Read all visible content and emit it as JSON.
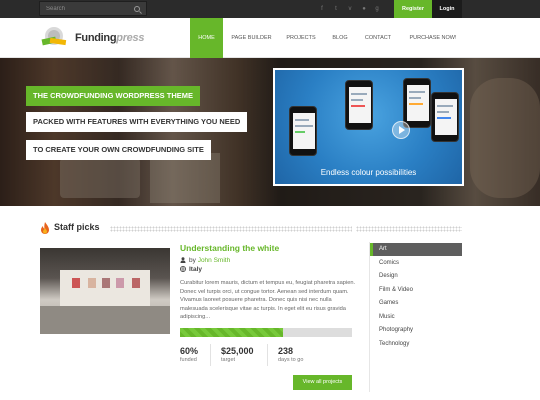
{
  "topbar": {
    "search_placeholder": "Search",
    "social_icons": [
      "facebook-icon",
      "twitter-icon",
      "vimeo-icon",
      "flickr-icon",
      "googleplus-icon",
      "rss-icon"
    ],
    "register_label": "Register",
    "login_label": "Login"
  },
  "logo": {
    "bold": "Funding",
    "light": "press"
  },
  "nav": {
    "items": [
      {
        "label": "HOME"
      },
      {
        "label": "PAGE BUILDER"
      },
      {
        "label": "PROJECTS"
      },
      {
        "label": "BLOG"
      },
      {
        "label": "CONTACT"
      },
      {
        "label": "PURCHASE NOW!"
      }
    ]
  },
  "hero": {
    "line1": "THE CROWDFUNDING WORDPRESS THEME",
    "line2": "PACKED WITH FEATURES WITH EVERYTHING YOU NEED",
    "line3": "TO CREATE YOUR OWN CROWDFUNDING SITE",
    "slide_caption": "Endless colour possibilities"
  },
  "staff": {
    "heading": "Staff picks",
    "project": {
      "title": "Understanding the white",
      "by_label": "by",
      "author": "John Smith",
      "location": "Italy",
      "description": "Curabitur lorem mauris, dictum et tempus eu, feugiat pharetra sapien. Donec vel turpis orci, ut congue tortor. Aenean sed interdum quam. Vivamus laoreet posuere pharetra. Donec quis nisi nec nulla malesuada scelerisque vitae ac turpis. In eget elit eu risus gravida adipiscing...",
      "progress_percent": 60,
      "stats": {
        "funded_value": "60%",
        "funded_label": "funded",
        "target_value": "$25,000",
        "target_label": "target",
        "days_value": "238",
        "days_label": "days to go"
      }
    },
    "view_all_label": "View all projects"
  },
  "categories": {
    "items": [
      {
        "label": "Art",
        "active": true
      },
      {
        "label": "Comics"
      },
      {
        "label": "Design"
      },
      {
        "label": "Film & Video"
      },
      {
        "label": "Games"
      },
      {
        "label": "Music"
      },
      {
        "label": "Photography"
      },
      {
        "label": "Technology"
      }
    ]
  },
  "colors": {
    "accent": "#67b72a",
    "topbar": "#2b2b2b",
    "slide_blue": "#2a7fc4"
  }
}
